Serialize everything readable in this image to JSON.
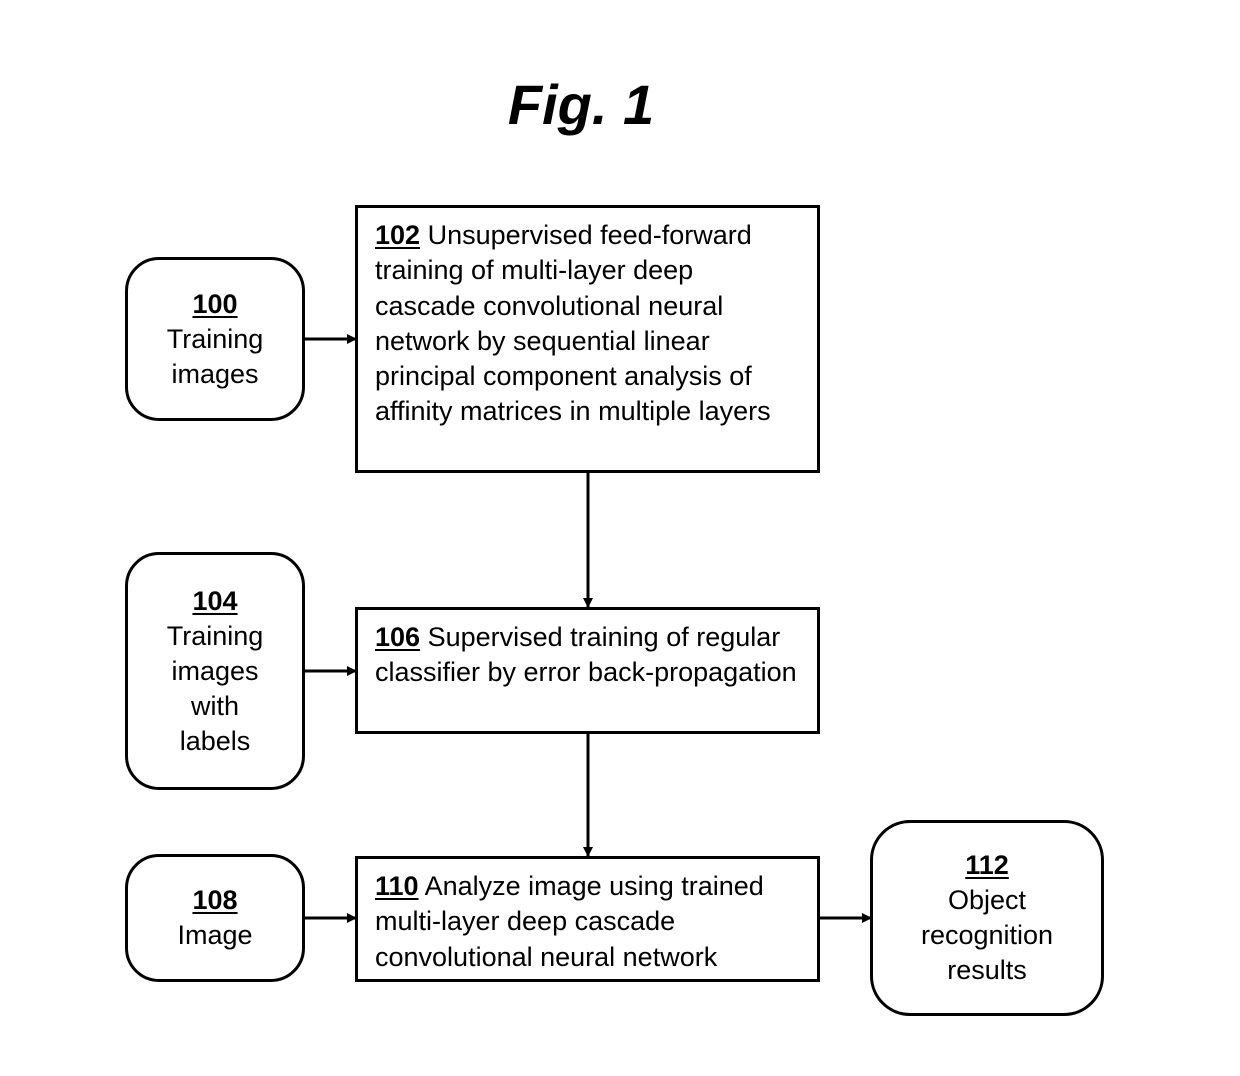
{
  "figure": {
    "title": "Fig. 1"
  },
  "nodes": {
    "n100": {
      "number": "100",
      "lines": [
        "Training",
        "images"
      ]
    },
    "n102": {
      "number": "102",
      "text": " Unsupervised feed-forward training of multi-layer deep cascade convolutional neural network by sequential linear principal component analysis of affinity matrices in multiple layers"
    },
    "n104": {
      "number": "104",
      "lines": [
        "Training",
        "images",
        "with",
        "labels"
      ]
    },
    "n106": {
      "number": "106",
      "text": " Supervised training of regular classifier by error back-propagation"
    },
    "n108": {
      "number": "108",
      "lines": [
        "Image"
      ]
    },
    "n110": {
      "number": "110",
      "text": " Analyze image using trained multi-layer deep cascade convolutional neural network"
    },
    "n112": {
      "number": "112",
      "lines": [
        "Object",
        "recognition",
        "results"
      ]
    }
  },
  "edges": [
    {
      "from": "100",
      "to": "102"
    },
    {
      "from": "102",
      "to": "106"
    },
    {
      "from": "104",
      "to": "106"
    },
    {
      "from": "106",
      "to": "110"
    },
    {
      "from": "108",
      "to": "110"
    },
    {
      "from": "110",
      "to": "112"
    }
  ]
}
